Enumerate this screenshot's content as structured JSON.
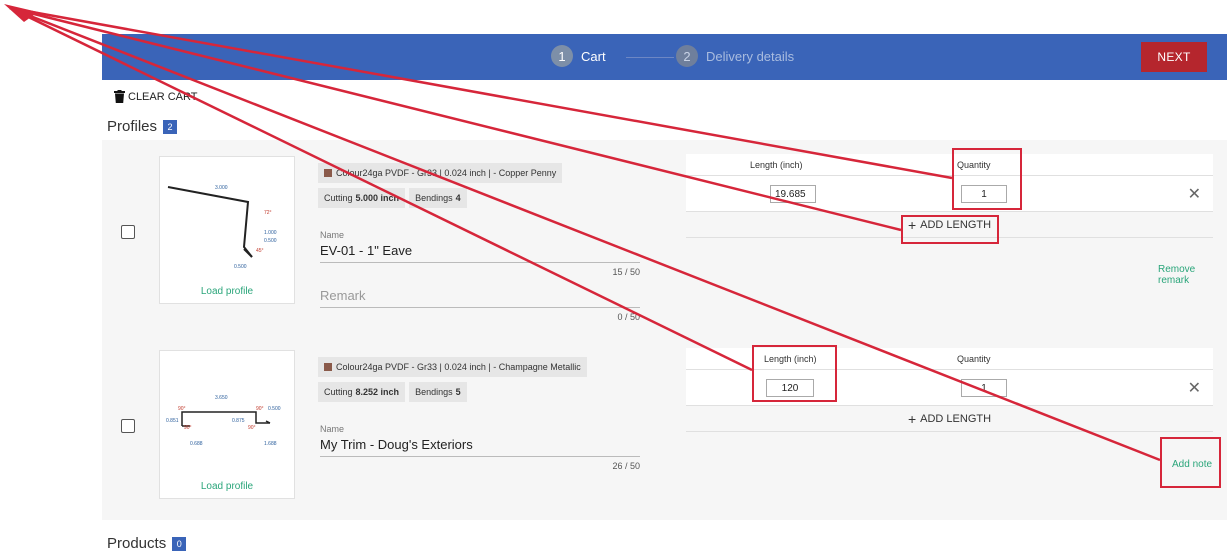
{
  "header": {
    "steps": [
      {
        "num": "1",
        "label": "Cart"
      },
      {
        "num": "2",
        "label": "Delivery details"
      }
    ],
    "next_label": "NEXT"
  },
  "clear_cart_label": "CLEAR CART",
  "profiles_section": {
    "title": "Profiles",
    "count": "2"
  },
  "products_section": {
    "title": "Products",
    "count": "0"
  },
  "profiles": [
    {
      "material": "Colour24ga PVDF - Gr33 | 0.024 inch | - Copper Penny",
      "material_color": "#8a5a4a",
      "cutting_label": "Cutting",
      "cutting_value": "5.000 inch",
      "bendings_label": "Bendings",
      "bendings_value": "4",
      "name_label": "Name",
      "name_value": "EV-01 - 1\" Eave",
      "name_count": "15 / 50",
      "remark_placeholder": "Remark",
      "remark_count": "0 / 50",
      "load_label": "Load profile",
      "length_header": "Length  (inch)",
      "quantity_header": "Quantity",
      "length_value": "19.685",
      "quantity_value": "1",
      "add_length_label": "ADD LENGTH",
      "note_link": "Remove remark",
      "drawing_labels": [
        "3.000",
        "72°",
        "1.000",
        "0.500",
        "45°",
        "0.500"
      ]
    },
    {
      "material": "Colour24ga PVDF - Gr33 | 0.024 inch | - Champagne Metallic",
      "material_color": "#8a5a4a",
      "cutting_label": "Cutting",
      "cutting_value": "8.252 inch",
      "bendings_label": "Bendings",
      "bendings_value": "5",
      "name_label": "Name",
      "name_value": "My Trim - Doug's Exteriors",
      "name_count": "26 / 50",
      "load_label": "Load profile",
      "length_header": "Length  (inch)",
      "quantity_header": "Quantity",
      "length_value": "120",
      "quantity_value": "1",
      "add_length_label": "ADD LENGTH",
      "note_link": "Add note",
      "drawing_labels": [
        "3.650",
        "90°",
        "90°",
        "0.500",
        "0.851",
        "0.875",
        "90°",
        "90°",
        "0.688",
        "1.688"
      ]
    }
  ],
  "colors": {
    "header_blue": "#3a64b8",
    "next_red": "#b5262d",
    "link_green": "#2aa57a",
    "annotation_red": "#d6263a"
  }
}
